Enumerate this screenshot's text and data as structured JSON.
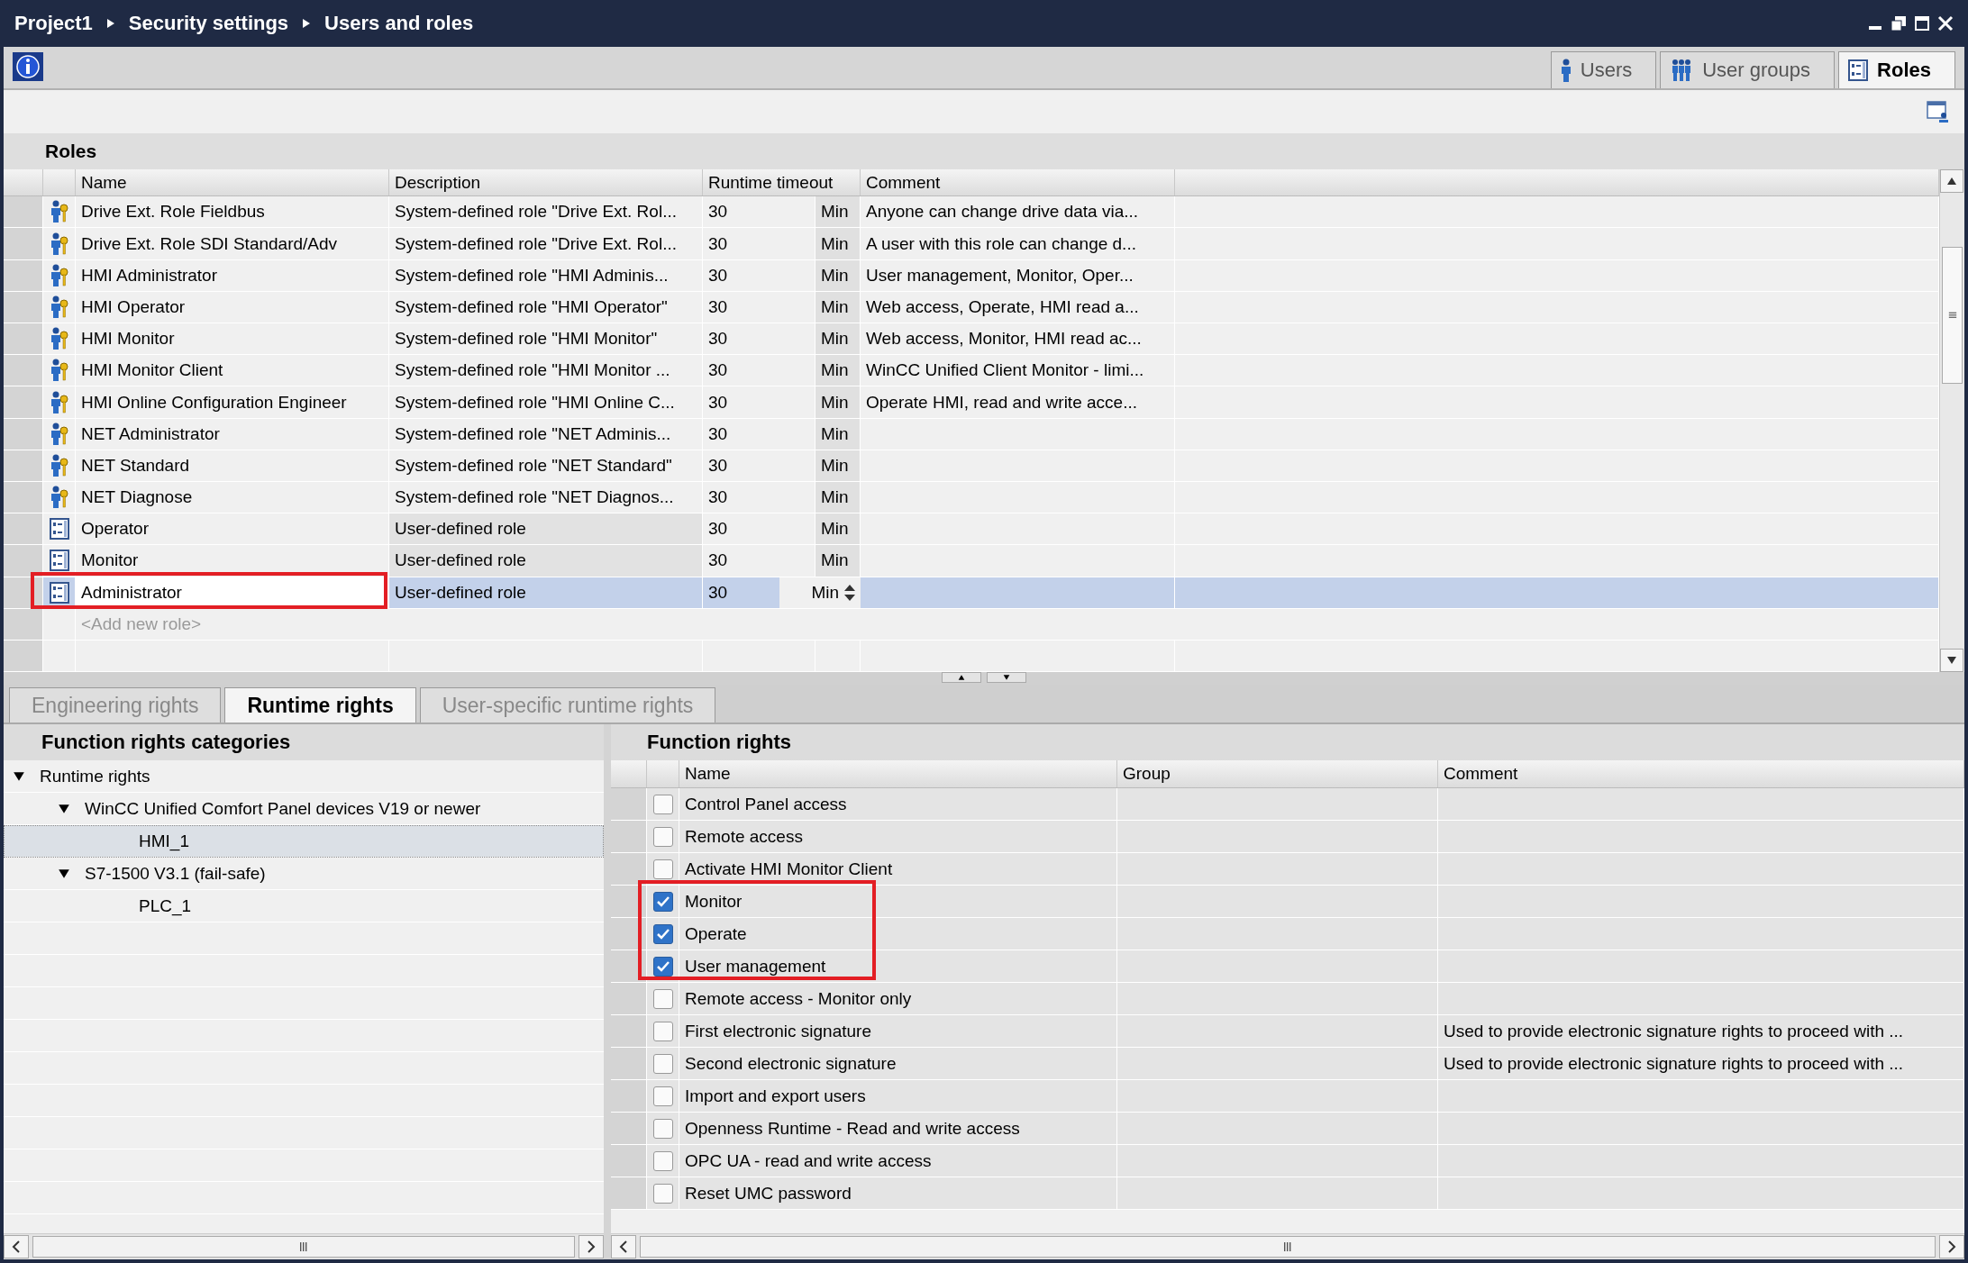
{
  "window": {
    "breadcrumb": [
      "Project1",
      "Security settings",
      "Users and roles"
    ]
  },
  "editor_tabs": [
    {
      "label": "Users",
      "selected": false
    },
    {
      "label": "User groups",
      "selected": false
    },
    {
      "label": "Roles",
      "selected": true
    }
  ],
  "roles": {
    "title": "Roles",
    "columns": [
      "Name",
      "Description",
      "Runtime timeout",
      "Comment"
    ],
    "rows": [
      {
        "kind": "system",
        "name": "Drive Ext. Role Fieldbus",
        "description": "System-defined role \"Drive Ext. Rol...",
        "timeout": "30",
        "unit": "Min",
        "comment": "Anyone can change drive data via...",
        "selected": false,
        "highlighted": false
      },
      {
        "kind": "system",
        "name": "Drive Ext. Role SDI Standard/Adv",
        "description": "System-defined role \"Drive Ext. Rol...",
        "timeout": "30",
        "unit": "Min",
        "comment": "A user with this role can change d...",
        "selected": false,
        "highlighted": false
      },
      {
        "kind": "system",
        "name": "HMI Administrator",
        "description": "System-defined role \"HMI Adminis...",
        "timeout": "30",
        "unit": "Min",
        "comment": "User management, Monitor, Oper...",
        "selected": false,
        "highlighted": false
      },
      {
        "kind": "system",
        "name": "HMI Operator",
        "description": "System-defined role \"HMI Operator\"",
        "timeout": "30",
        "unit": "Min",
        "comment": "Web access, Operate, HMI read a...",
        "selected": false,
        "highlighted": false
      },
      {
        "kind": "system",
        "name": "HMI Monitor",
        "description": "System-defined role \"HMI Monitor\"",
        "timeout": "30",
        "unit": "Min",
        "comment": "Web access, Monitor, HMI read ac...",
        "selected": false,
        "highlighted": false
      },
      {
        "kind": "system",
        "name": "HMI Monitor Client",
        "description": "System-defined role \"HMI Monitor ...",
        "timeout": "30",
        "unit": "Min",
        "comment": "WinCC Unified Client Monitor - limi...",
        "selected": false,
        "highlighted": false
      },
      {
        "kind": "system",
        "name": "HMI Online Configuration Engineer",
        "description": "System-defined role \"HMI Online C...",
        "timeout": "30",
        "unit": "Min",
        "comment": "Operate HMI, read and write acce...",
        "selected": false,
        "highlighted": false
      },
      {
        "kind": "system",
        "name": "NET Administrator",
        "description": "System-defined role \"NET Adminis...",
        "timeout": "30",
        "unit": "Min",
        "selected": false,
        "highlighted": false
      },
      {
        "kind": "system",
        "name": "NET Standard",
        "description": "System-defined role \"NET Standard\"",
        "timeout": "30",
        "unit": "Min",
        "selected": false,
        "highlighted": false
      },
      {
        "kind": "system",
        "name": "NET Diagnose",
        "description": "System-defined role \"NET Diagnos...",
        "timeout": "30",
        "unit": "Min",
        "selected": false,
        "highlighted": false
      },
      {
        "kind": "user",
        "name": "Operator",
        "description": "User-defined role",
        "timeout": "30",
        "unit": "Min",
        "selected": false,
        "highlighted": false
      },
      {
        "kind": "user",
        "name": "Monitor",
        "description": "User-defined role",
        "timeout": "30",
        "unit": "Min",
        "selected": false,
        "highlighted": false
      },
      {
        "kind": "user",
        "name": "Administrator",
        "description": "User-defined role",
        "timeout": "30",
        "unit": "Min",
        "selected": true,
        "highlighted": true
      }
    ],
    "add_placeholder": "<Add new role>"
  },
  "rights_tabs": [
    {
      "label": "Engineering rights",
      "selected": false
    },
    {
      "label": "Runtime rights",
      "selected": true
    },
    {
      "label": "User-specific runtime rights",
      "selected": false
    }
  ],
  "categories": {
    "title": "Function rights categories",
    "tree": [
      {
        "label": "Runtime rights",
        "expanded": true,
        "selected": false,
        "children": [
          {
            "label": "WinCC Unified Comfort Panel devices V19 or newer",
            "expanded": true,
            "selected": false,
            "children": [
              {
                "label": "HMI_1",
                "selected": true
              }
            ]
          },
          {
            "label": "S7-1500 V3.1 (fail-safe)",
            "expanded": true,
            "selected": false,
            "children": [
              {
                "label": "PLC_1",
                "selected": false
              }
            ]
          }
        ]
      }
    ]
  },
  "function_rights": {
    "title": "Function rights",
    "columns": [
      "Name",
      "Group",
      "Comment"
    ],
    "rows": [
      {
        "name": "Control Panel access",
        "checked": false,
        "highlighted": false
      },
      {
        "name": "Remote access",
        "checked": false,
        "highlighted": false
      },
      {
        "name": "Activate HMI Monitor Client",
        "checked": false,
        "highlighted": false
      },
      {
        "name": "Monitor",
        "checked": true,
        "highlighted": true
      },
      {
        "name": "Operate",
        "checked": true,
        "highlighted": true
      },
      {
        "name": "User management",
        "checked": true,
        "highlighted": true
      },
      {
        "name": "Remote access - Monitor only",
        "checked": false,
        "highlighted": false
      },
      {
        "name": "First electronic signature",
        "checked": false,
        "highlighted": false,
        "comment": "Used to provide electronic signature rights to proceed with ..."
      },
      {
        "name": "Second electronic signature",
        "checked": false,
        "highlighted": false,
        "comment": "Used to provide electronic signature rights to proceed with ..."
      },
      {
        "name": "Import and export users",
        "checked": false,
        "highlighted": false
      },
      {
        "name": "Openness Runtime - Read and write access",
        "checked": false,
        "highlighted": false
      },
      {
        "name": "OPC UA - read and write access",
        "checked": false,
        "highlighted": false
      },
      {
        "name": "Reset UMC password",
        "checked": false,
        "highlighted": false
      }
    ]
  }
}
